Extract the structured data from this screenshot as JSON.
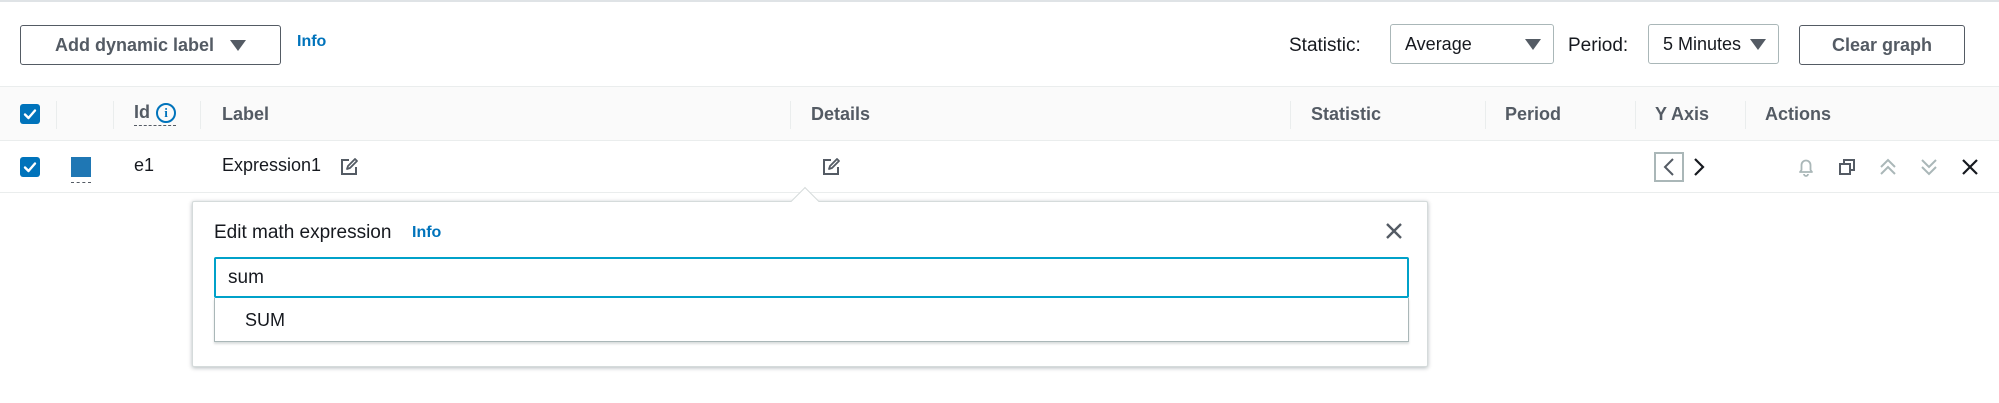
{
  "toolbar": {
    "add_dynamic_label": "Add dynamic label",
    "info": "Info",
    "statistic_label": "Statistic:",
    "statistic_value": "Average",
    "period_label": "Period:",
    "period_value": "5 Minutes",
    "clear_graph": "Clear graph"
  },
  "table": {
    "headers": {
      "id": "Id",
      "label": "Label",
      "details": "Details",
      "statistic": "Statistic",
      "period": "Period",
      "y_axis": "Y Axis",
      "actions": "Actions"
    },
    "rows": [
      {
        "checked": true,
        "color": "#1f77b4",
        "id": "e1",
        "label": "Expression1",
        "details": "",
        "statistic": "",
        "period": ""
      }
    ]
  },
  "popover": {
    "title": "Edit math expression",
    "info": "Info",
    "input_value": "sum",
    "suggestions": [
      "SUM"
    ]
  },
  "colors": {
    "accent": "#0073bb",
    "series": "#1f77b4",
    "primary_button": "#ec7211",
    "focus_border": "#00a1c9"
  }
}
